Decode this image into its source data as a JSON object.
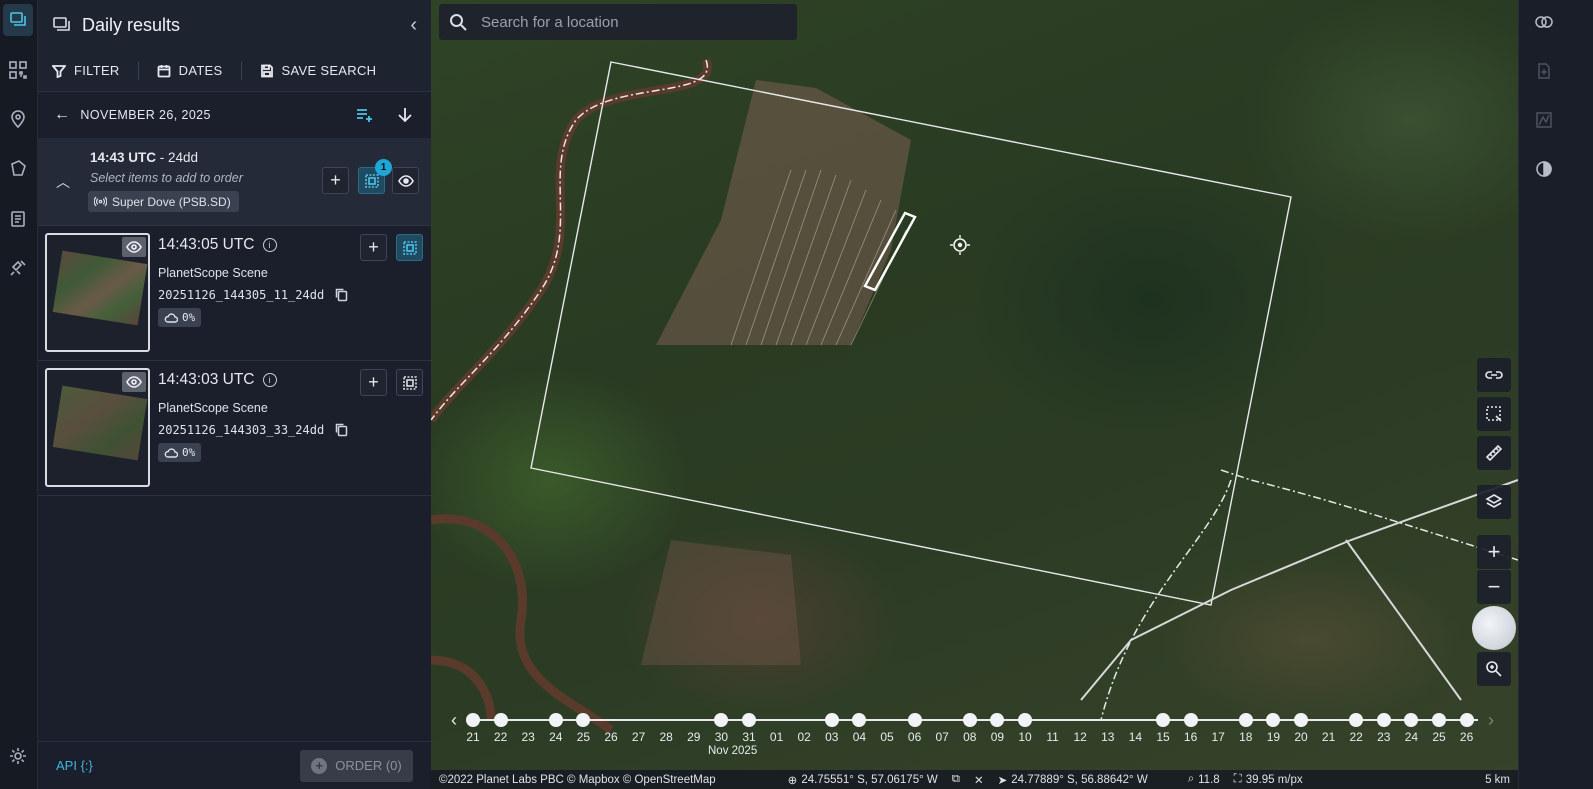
{
  "panel": {
    "title": "Daily results",
    "toolbar": {
      "filter": "FILTER",
      "dates": "DATES",
      "save_search": "SAVE SEARCH"
    },
    "date_header": "NOVEMBER 26, 2025",
    "group": {
      "time": "14:43 UTC",
      "suffix": " - 24dd",
      "hint": "Select items to add to order",
      "chip": "Super Dove (PSB.SD)",
      "selected_count": "1"
    },
    "items": [
      {
        "time": "14:43:05 UTC",
        "type": "PlanetScope Scene",
        "id": "20251126_144305_11_24dd",
        "cloud": "0%",
        "selected": true
      },
      {
        "time": "14:43:03 UTC",
        "type": "PlanetScope Scene",
        "id": "20251126_144303_33_24dd",
        "cloud": "0%",
        "selected": false
      }
    ],
    "footer": {
      "api": "API {:}",
      "order": "ORDER (0)"
    }
  },
  "map": {
    "search_placeholder": "Search for a location",
    "timeline": {
      "labels": [
        "21",
        "22",
        "23",
        "24",
        "25",
        "26",
        "27",
        "28",
        "29",
        "30",
        "31",
        "01",
        "02",
        "03",
        "04",
        "05",
        "06",
        "07",
        "08",
        "09",
        "10",
        "11",
        "12",
        "13",
        "14",
        "15",
        "16",
        "17",
        "18",
        "19",
        "20",
        "21",
        "22",
        "23",
        "24",
        "25",
        "26"
      ],
      "dots": [
        "21",
        "22",
        "24",
        "25",
        "30",
        "31",
        "03",
        "04",
        "06",
        "08",
        "09",
        "10",
        "15",
        "16",
        "18",
        "19",
        "20",
        "22",
        "23",
        "24",
        "25",
        "26"
      ],
      "month": "Nov 2025"
    },
    "footer": {
      "attribution": "©2022 Planet Labs PBC © Mapbox © OpenStreetMap",
      "cursor_coords": "24.75551° S, 57.06175° W",
      "center_coords": "24.77889° S, 56.88642° W",
      "zoom": "11.8",
      "resolution": "39.95 m/px",
      "scale": "5 km"
    }
  },
  "colors": {
    "accent": "#1ea6d6",
    "panel_bg": "#1a1f2b",
    "group_bg": "#242a37"
  }
}
